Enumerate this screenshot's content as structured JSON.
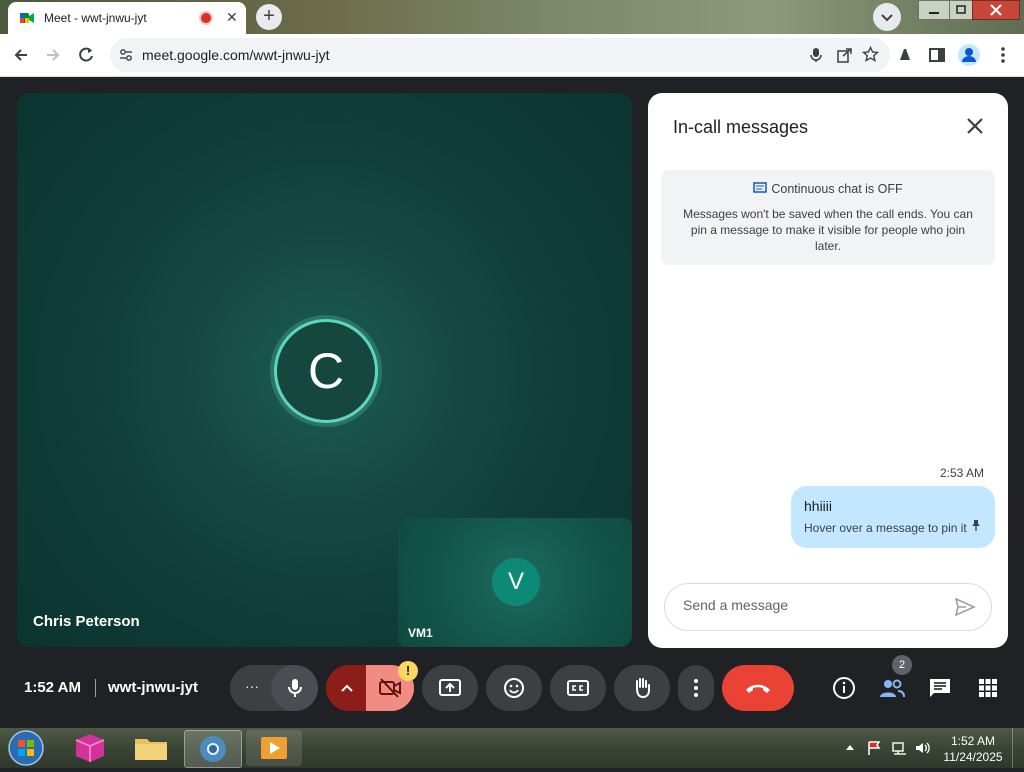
{
  "browser": {
    "tab_title": "Meet - wwt-jnwu-jyt",
    "url": "meet.google.com/wwt-jnwu-jyt"
  },
  "meet": {
    "main_tile": {
      "avatar_letter": "C",
      "participant_name": "Chris Peterson"
    },
    "pip_tile": {
      "avatar_letter": "V",
      "participant_name": "VM1"
    },
    "chat": {
      "title": "In-call messages",
      "notice_title": "Continuous chat is OFF",
      "notice_body": "Messages won't be saved when the call ends. You can pin a message to make it visible for people who join later.",
      "message_time": "2:53 AM",
      "message_text": "hhiiii",
      "message_hint": "Hover over a message to pin it",
      "input_placeholder": "Send a message"
    },
    "controls": {
      "time": "1:52 AM",
      "meeting_code": "wwt-jnwu-jyt",
      "more_dots": "···",
      "people_count": "2",
      "camera_warning": "!"
    },
    "colors": {
      "end_call": "#ea4335",
      "camera_off": "#f28b82",
      "accent": "#8ab4f8"
    }
  },
  "taskbar": {
    "clock_time": "1:52 AM",
    "clock_date": "11/24/2025"
  }
}
